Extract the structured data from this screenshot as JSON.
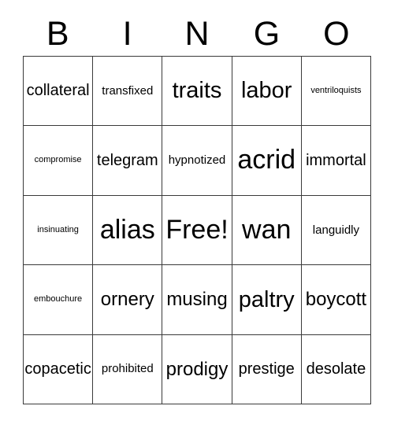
{
  "card": {
    "title_letters": [
      "B",
      "I",
      "N",
      "G",
      "O"
    ],
    "free_space_label": "Free!",
    "border_color": "#3a3a3a",
    "text_color": "#000000",
    "background_color": "#ffffff",
    "grid_size": "5x5",
    "rows": [
      [
        {
          "word": "collateral",
          "size": "fs-m"
        },
        {
          "word": "transfixed",
          "size": "fs-s"
        },
        {
          "word": "traits",
          "size": "fs-xl"
        },
        {
          "word": "labor",
          "size": "fs-xl"
        },
        {
          "word": "ventriloquists",
          "size": "fs-xs"
        }
      ],
      [
        {
          "word": "compromise",
          "size": "fs-xs"
        },
        {
          "word": "telegram",
          "size": "fs-m"
        },
        {
          "word": "hypnotized",
          "size": "fs-s"
        },
        {
          "word": "acrid",
          "size": "fs-xxl"
        },
        {
          "word": "immortal",
          "size": "fs-m"
        }
      ],
      [
        {
          "word": "insinuating",
          "size": "fs-xs"
        },
        {
          "word": "alias",
          "size": "fs-xxl"
        },
        {
          "word": "Free!",
          "size": "fs-xxl"
        },
        {
          "word": "wan",
          "size": "fs-xxl"
        },
        {
          "word": "languidly",
          "size": "fs-s"
        }
      ],
      [
        {
          "word": "embouchure",
          "size": "fs-xs"
        },
        {
          "word": "ornery",
          "size": "fs-l"
        },
        {
          "word": "musing",
          "size": "fs-l"
        },
        {
          "word": "paltry",
          "size": "fs-xl"
        },
        {
          "word": "boycott",
          "size": "fs-l"
        }
      ],
      [
        {
          "word": "copacetic",
          "size": "fs-m"
        },
        {
          "word": "prohibited",
          "size": "fs-s"
        },
        {
          "word": "prodigy",
          "size": "fs-l"
        },
        {
          "word": "prestige",
          "size": "fs-m"
        },
        {
          "word": "desolate",
          "size": "fs-m"
        }
      ]
    ]
  }
}
